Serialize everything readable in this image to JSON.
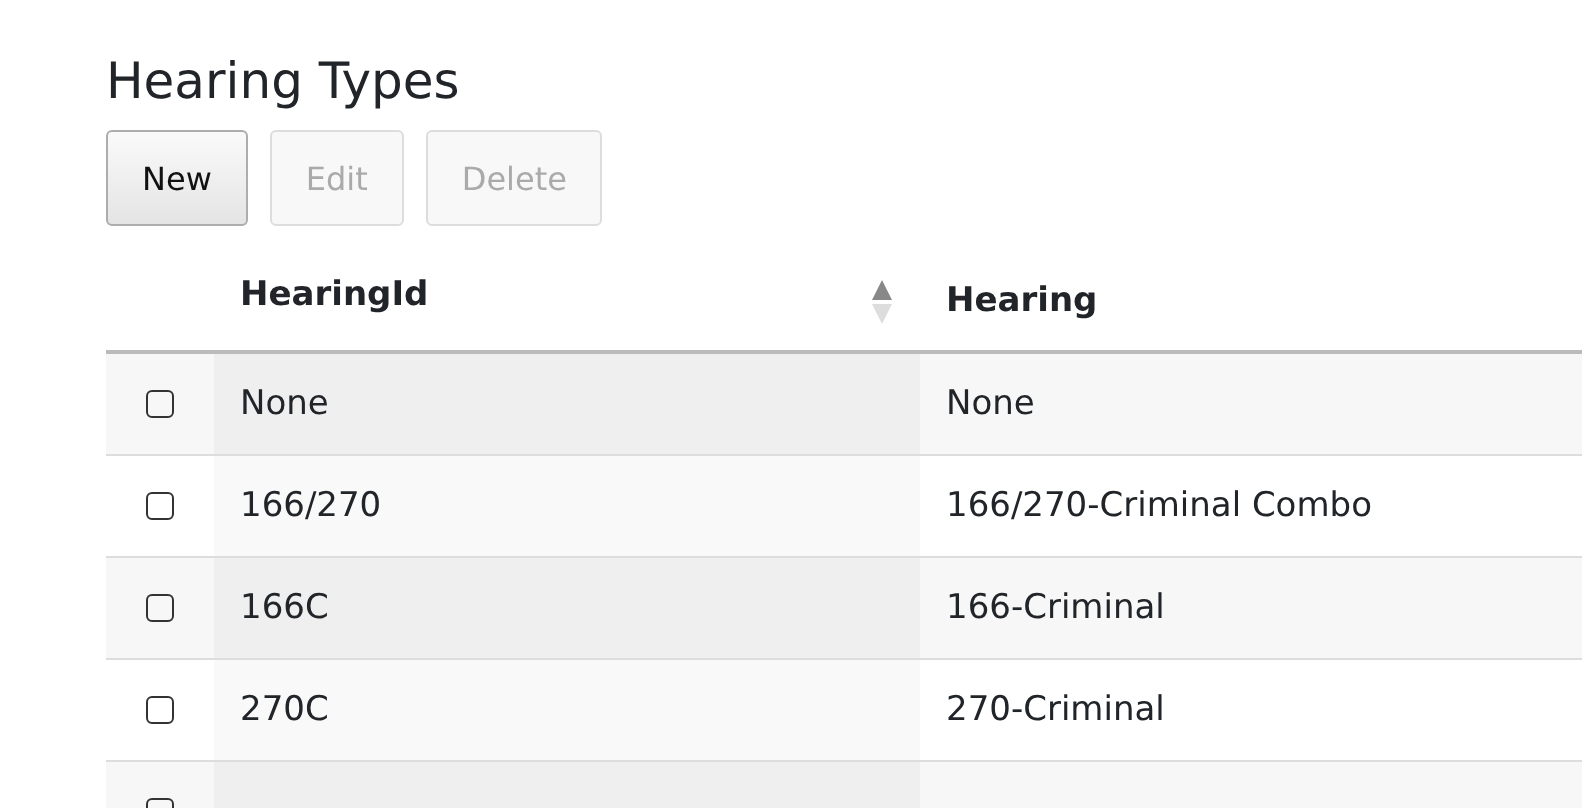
{
  "title": "Hearing Types",
  "buttons": [
    {
      "label": "New",
      "disabled": false
    },
    {
      "label": "Edit",
      "disabled": true
    },
    {
      "label": "Delete",
      "disabled": true
    }
  ],
  "table": {
    "columns": [
      {
        "label": "HearingId",
        "sorted": true
      },
      {
        "label": "Hearing",
        "sorted": false
      }
    ],
    "rows": [
      {
        "selected": false,
        "cells": [
          "None",
          "None"
        ]
      },
      {
        "selected": false,
        "cells": [
          "166/270",
          "166/270-Criminal Combo"
        ]
      },
      {
        "selected": false,
        "cells": [
          "166C",
          "166-Criminal"
        ]
      },
      {
        "selected": false,
        "cells": [
          "270C",
          "270-Criminal"
        ]
      },
      {
        "selected": false
      }
    ]
  }
}
